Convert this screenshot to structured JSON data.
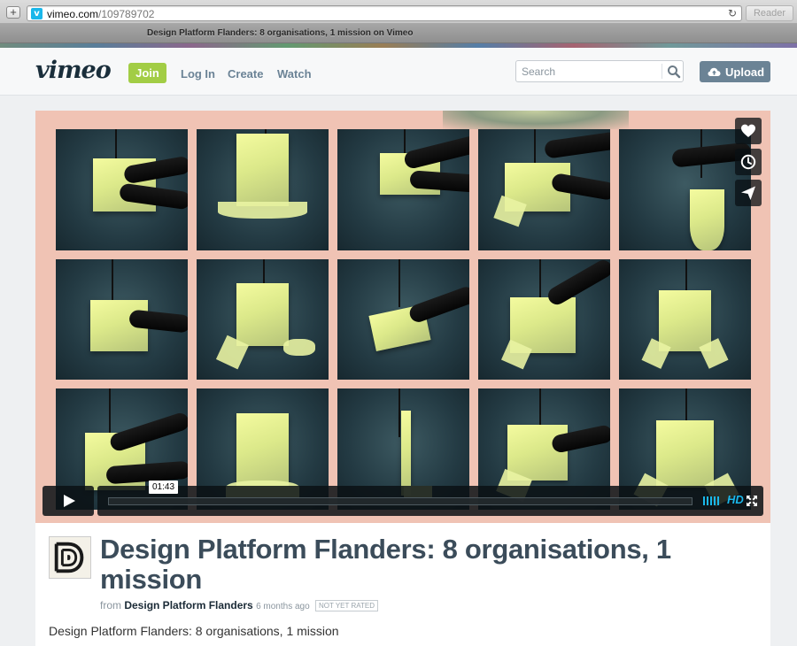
{
  "browser": {
    "url_domain": "vimeo.com",
    "url_path": "/109789702",
    "reader_label": "Reader",
    "tab_title": "Design Platform Flanders: 8 organisations, 1 mission on Vimeo",
    "icons": {
      "add": "plus-icon",
      "favicon": "vimeo-favicon",
      "reload": "reload-icon"
    }
  },
  "header": {
    "logo": "vimeo",
    "join_label": "Join",
    "nav": [
      {
        "label": "Log In"
      },
      {
        "label": "Create"
      },
      {
        "label": "Watch"
      }
    ],
    "search_placeholder": "Search",
    "upload_label": "Upload",
    "colors": {
      "join": "#a2cd45",
      "upload": "#6b8395",
      "nav": "#6b8396",
      "logo": "#1a2e3b"
    }
  },
  "player": {
    "time_tooltip": "01:43",
    "hd_label": "HD",
    "side_actions": [
      "heart-icon",
      "clock-icon",
      "send-icon"
    ],
    "accent": "#1ab7ea"
  },
  "video": {
    "title": "Design Platform Flanders: 8 organisations, 1 mission",
    "from_label": "from",
    "owner": "Design Platform Flanders",
    "uploaded_ago": "6 months ago",
    "rating": "NOT YET RATED",
    "description": "Design Platform Flanders: 8 organisations, 1 mission"
  }
}
